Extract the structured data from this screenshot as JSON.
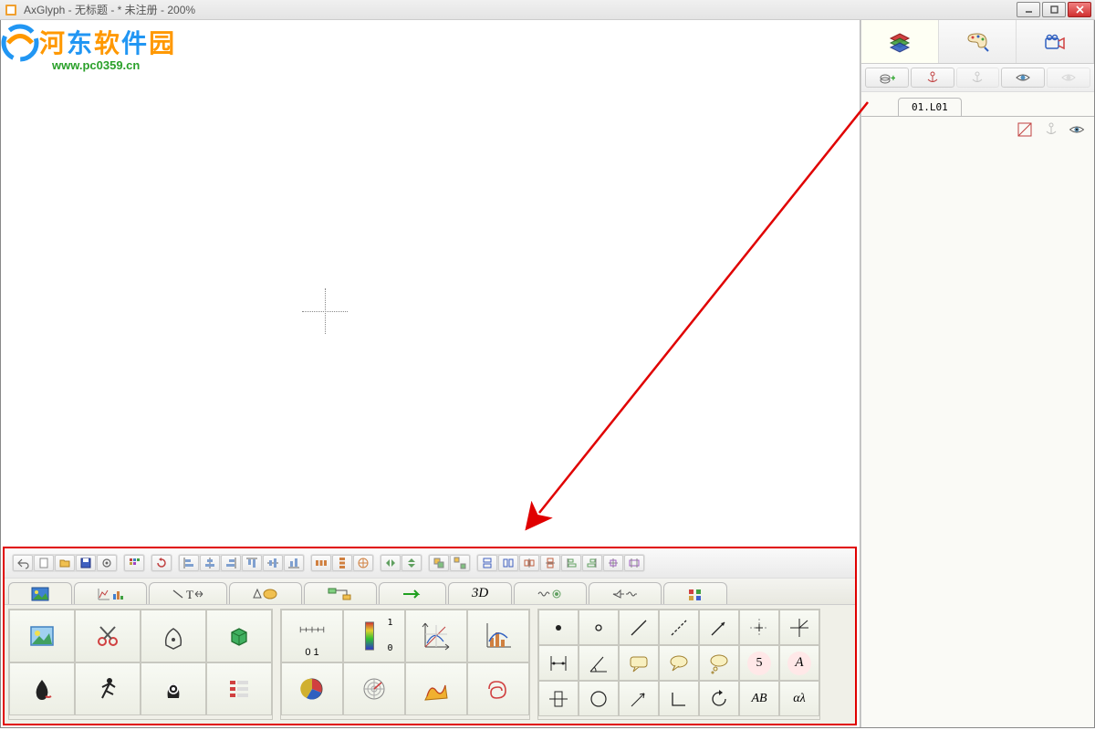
{
  "window": {
    "title": "AxGlyph - 无标题 - * 未注册 - 200%"
  },
  "watermark": {
    "brand_chars": [
      "河",
      "东",
      "软",
      "件",
      "园"
    ],
    "url": "www.pc0359.cn"
  },
  "right_panel": {
    "tabs": [
      "layers",
      "palette",
      "camera"
    ],
    "toolbar": [
      "add-layer",
      "anchor",
      "anchor-down",
      "visible",
      "visible-dim"
    ],
    "layer_label": "01.L01"
  },
  "tabs": [
    {
      "id": "image",
      "label": ""
    },
    {
      "id": "chart",
      "label": ""
    },
    {
      "id": "text",
      "label": ""
    },
    {
      "id": "shapes",
      "label": ""
    },
    {
      "id": "flow",
      "label": ""
    },
    {
      "id": "arrow",
      "label": ""
    },
    {
      "id": "3d",
      "label": "3D"
    },
    {
      "id": "spring",
      "label": ""
    },
    {
      "id": "circuit",
      "label": ""
    },
    {
      "id": "misc",
      "label": ""
    }
  ],
  "toolbar_groups": [
    [
      "undo-btn",
      "new-btn",
      "open-btn",
      "save-btn",
      "settings-btn"
    ],
    [
      "grid-btn"
    ],
    [
      "replay-btn"
    ],
    [
      "align-left",
      "align-center-h",
      "align-right",
      "align-top",
      "align-center-v",
      "align-bottom"
    ],
    [
      "distribute-h",
      "distribute-v",
      "distribute-center"
    ],
    [
      "flip-h",
      "flip-v"
    ],
    [
      "group-btn",
      "ungroup-btn"
    ],
    [
      "same-width",
      "same-height",
      "same-center-h",
      "same-center-v",
      "same-left",
      "same-right",
      "same-center",
      "same-stretch"
    ]
  ],
  "palette": {
    "block1": [
      "image-tool",
      "scissors-tool",
      "pen-tool",
      "cube-tool",
      "ink-tool",
      "run-tool",
      "gear-head-tool",
      "list-tool"
    ],
    "block2_labels": {
      "ruler": "0 1",
      "gradient_hi": "1",
      "gradient_lo": "0"
    },
    "block2": [
      "ruler-tool",
      "gradient-tool",
      "axes-tool",
      "stats-tool",
      "pie-tool",
      "radar-tool",
      "surface-tool",
      "spiral-tool"
    ],
    "block3_labels": {
      "five": "5",
      "ab": "AB",
      "alpha": "αλ",
      "italic_a": "A"
    },
    "block3": [
      "dot-filled",
      "dot-empty",
      "line",
      "dashed-line",
      "arrow-line",
      "crosshair",
      "angle-tool",
      "tie-fighter",
      "angle-measure",
      "speech-1",
      "speech-2",
      "speech-3",
      "num-5",
      "italic-a",
      "cross-square",
      "circle-shape",
      "arrow-diag",
      "corner",
      "rotate-ccw",
      "label-ab",
      "label-alpha"
    ]
  }
}
